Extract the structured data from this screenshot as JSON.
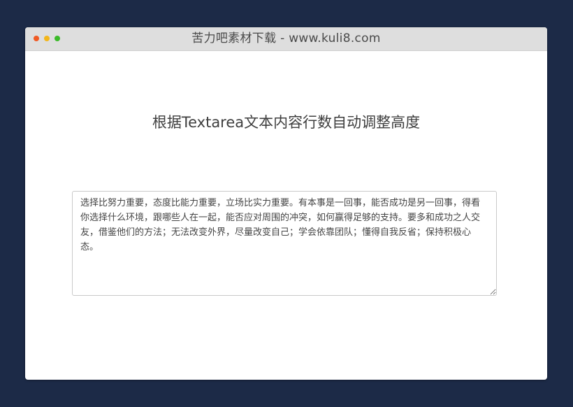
{
  "window": {
    "title": "苦力吧素材下载 - www.kuli8.com",
    "controls": [
      "close-dot",
      "minimize-dot",
      "zoom-dot"
    ]
  },
  "page": {
    "heading": "根据Textarea文本内容行数自动调整高度"
  },
  "textarea": {
    "value": "选择比努力重要，态度比能力重要，立场比实力重要。有本事是一回事，能否成功是另一回事，得看你选择什么环境，跟哪些人在一起，能否应对周围的冲突，如何赢得足够的支持。要多和成功之人交友，借鉴他们的方法；无法改变外界，尽量改变自己；学会依靠团队；懂得自我反省；保持积极心态。"
  },
  "colors": {
    "background": "#1c2a47",
    "titlebar": "#dedede",
    "close": "#f05a24",
    "minimize": "#f3b61a",
    "zoom": "#3cbb2a"
  }
}
